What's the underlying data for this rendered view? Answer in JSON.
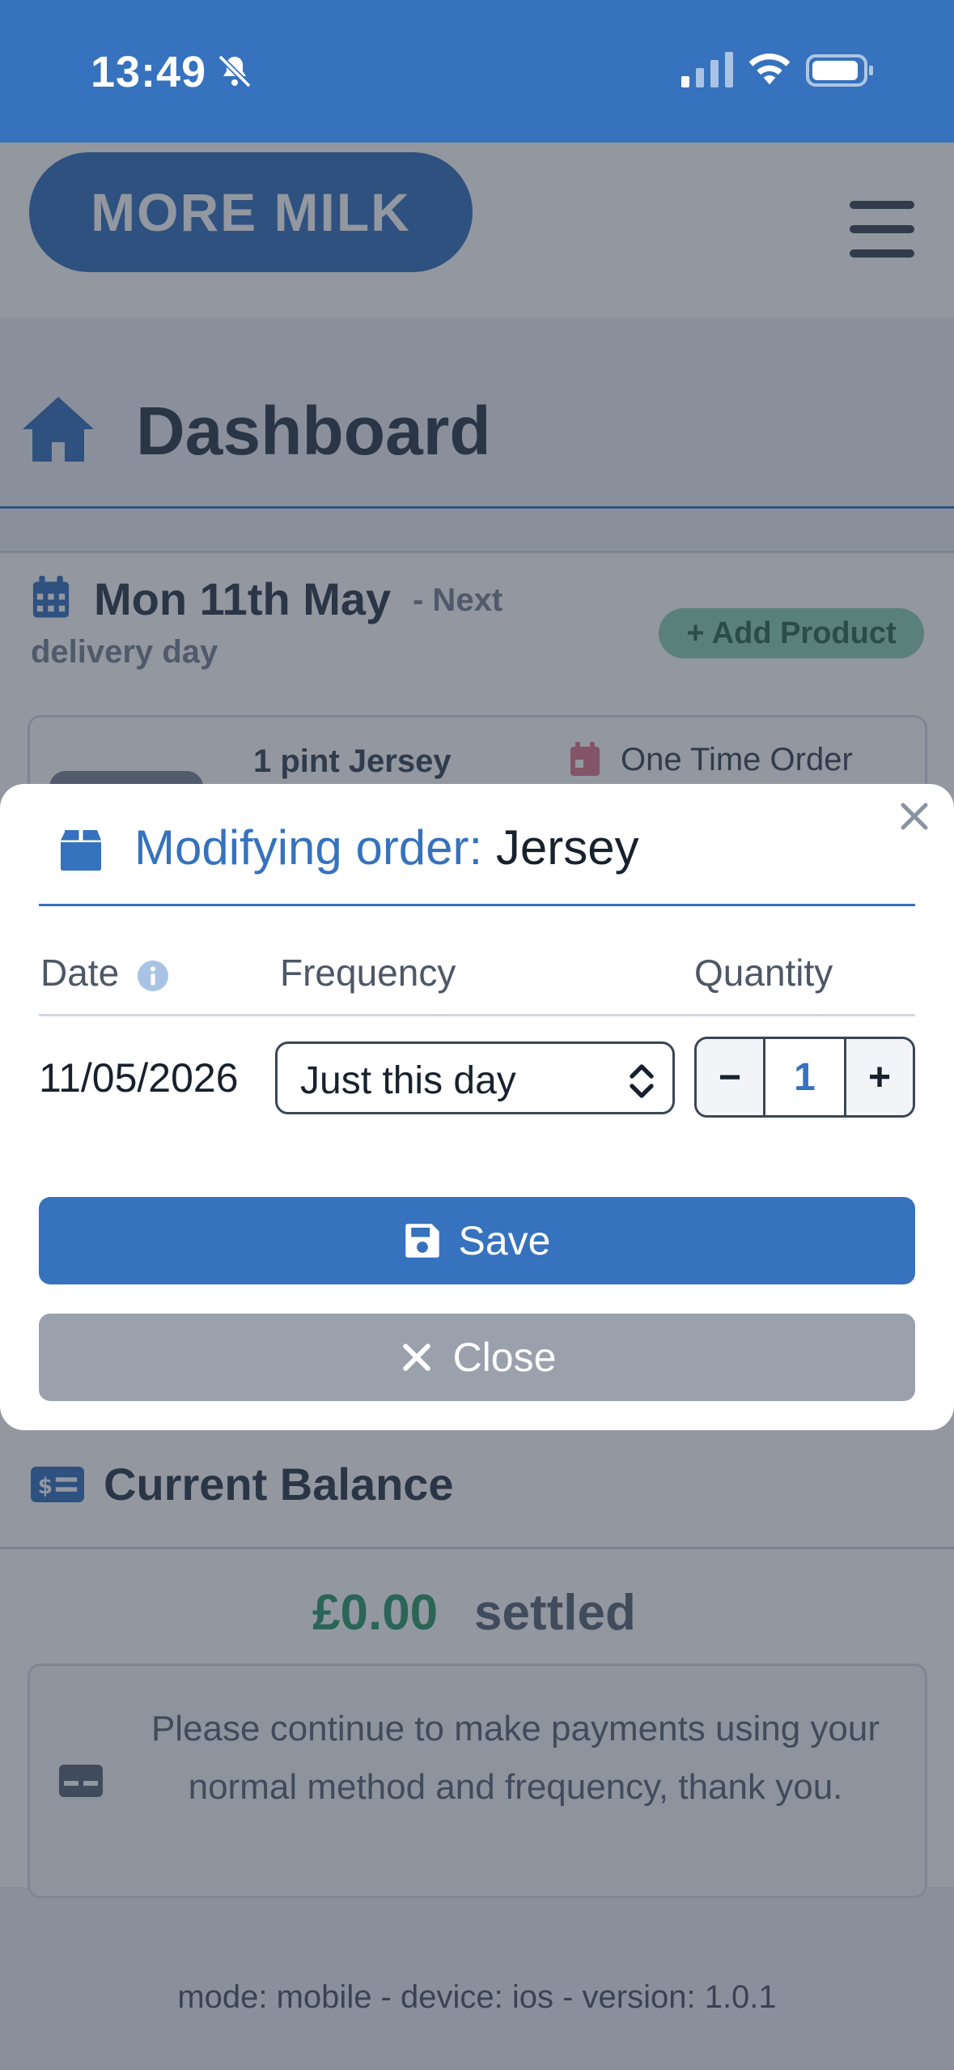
{
  "status_bar": {
    "time": "13:49",
    "icons": [
      "bell-slash-icon",
      "signal-icon",
      "wifi-icon",
      "battery-icon"
    ]
  },
  "nav": {
    "logo": "MORE MILK",
    "menu_icon": "hamburger-icon"
  },
  "dashboard": {
    "title": "Dashboard",
    "icon": "home-icon"
  },
  "delivery": {
    "date": "Mon 11th May",
    "next_label": "- Next",
    "next_label_2": "delivery day",
    "add_product": "+ Add Product",
    "product": {
      "name": "1 pint Jersey",
      "type": "One Time Order"
    }
  },
  "modal": {
    "title_label": "Modifying order:",
    "title_value": "Jersey",
    "headers": {
      "date": "Date",
      "frequency": "Frequency",
      "quantity": "Quantity"
    },
    "row": {
      "date": "11/05/2026",
      "frequency": "Just this day",
      "quantity": "1"
    },
    "stepper": {
      "minus": "−",
      "plus": "+"
    },
    "save_label": "Save",
    "close_label": "Close"
  },
  "balance": {
    "title": "Current Balance",
    "amount": "£0.00",
    "status": "settled",
    "note": "Please continue to make payments using your normal method and frequency, thank you."
  },
  "footer": "mode: mobile  -  device: ios  -  version: 1.0.1",
  "colors": {
    "primary": "#3672bd",
    "success": "#2f9a6b",
    "muted": "#9aa1ad"
  }
}
